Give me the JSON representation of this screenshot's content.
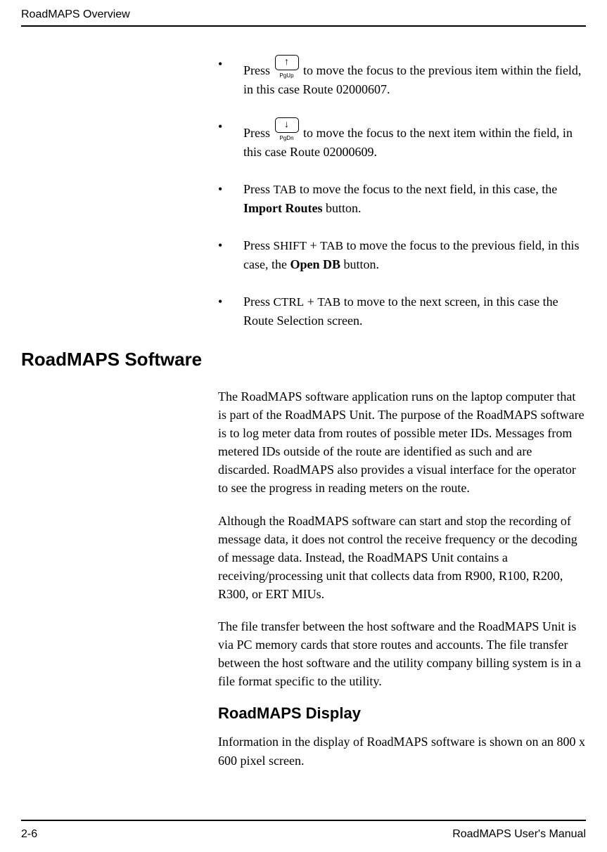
{
  "header": {
    "title": "RoadMAPS Overview"
  },
  "bullets": {
    "b1": {
      "prefix": "Press ",
      "keyLabel": "PgUp",
      "suffix": " to move the focus to the previous item within the field, in this case Route 02000607."
    },
    "b2": {
      "prefix": "Press ",
      "keyLabel": "PgDn",
      "suffix": " to move the focus to the next item within the field, in this case Route 02000609."
    },
    "b3": {
      "p1": "Press ",
      "sc1": "TAB",
      "p2": " to move the focus to the next field, in this case, the ",
      "bold": "Import Routes",
      "p3": " button."
    },
    "b4": {
      "p1": "Press ",
      "sc1": "SHIFT",
      "plus": " + ",
      "sc2": "TAB",
      "p2": " to move the focus to the previous field, in this case, the ",
      "bold": "Open DB",
      "p3": " button."
    },
    "b5": {
      "p1": "Press ",
      "sc1": "CTRL",
      "plus": " + ",
      "sc2": "TAB",
      "p2": " to move to the next screen, in this case the Route Selection screen."
    }
  },
  "section": {
    "title": "RoadMAPS Software"
  },
  "paras": {
    "p1": "The RoadMAPS software application runs on the laptop computer that is part of the RoadMAPS Unit. The purpose of the RoadMAPS software is to log meter data from routes of possible meter IDs. Messages from metered IDs outside of the route are identified as such and are discarded. RoadMAPS also provides a visual interface for the operator to see the progress in reading meters on the route.",
    "p2": "Although the RoadMAPS software can start and stop the recording of message data, it does not control the receive frequency or the decoding of message data. Instead, the RoadMAPS Unit contains a receiving/processing unit that collects data from R900, R100, R200, R300, or ERT MIUs.",
    "p3": "The file transfer between the host software and the RoadMAPS Unit is via PC memory cards that store routes and accounts. The file transfer between the host software and the utility company billing system is in a file format specific to the utility."
  },
  "subsection": {
    "title": "RoadMAPS Display"
  },
  "subpara": "Information in the display of RoadMAPS software is shown on an 800 x 600 pixel screen.",
  "footer": {
    "left": "2-6",
    "right": "RoadMAPS User's Manual"
  }
}
